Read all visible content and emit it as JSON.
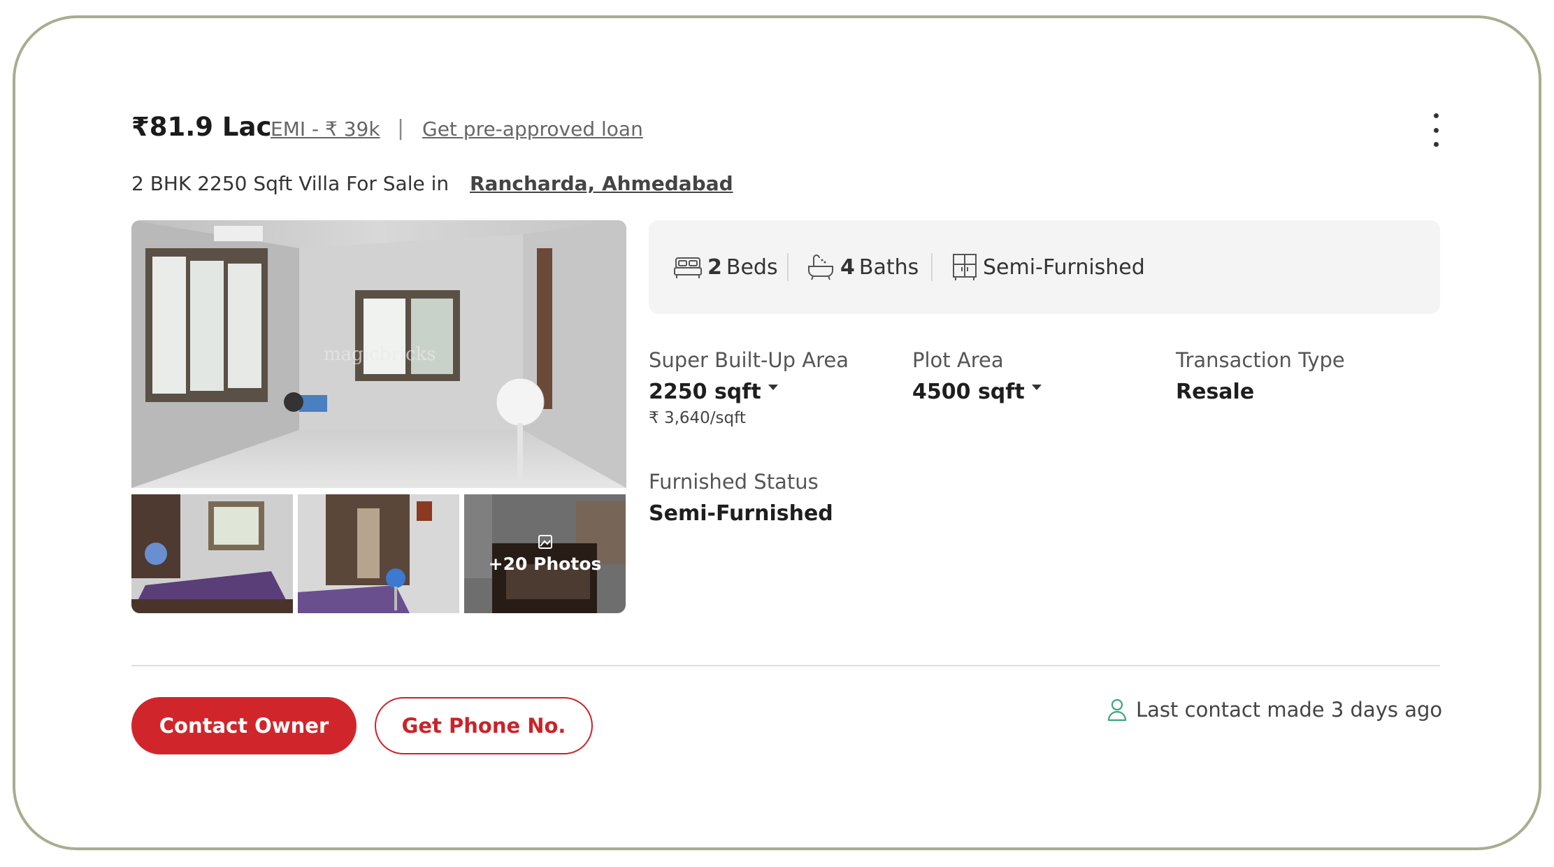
{
  "listing": {
    "price": "₹81.9 Lac",
    "emi_label": "EMI - ₹ 39k",
    "separator": "|",
    "loan_link": "Get pre-approved loan",
    "title_prefix": "2 BHK 2250 Sqft Villa For Sale in",
    "locality": "Rancharda, Ahmedabad"
  },
  "gallery": {
    "more_photos_label": "+20 Photos",
    "watermark": "magicbricks"
  },
  "amenities": {
    "beds_count": "2",
    "beds_label": "Beds",
    "baths_count": "4",
    "baths_label": "Baths",
    "furnishing": "Semi-Furnished"
  },
  "details": {
    "super_area_label": "Super Built-Up Area",
    "super_area_value": "2250 sqft",
    "price_per_sqft": "₹ 3,640/sqft",
    "plot_area_label": "Plot Area",
    "plot_area_value": "4500 sqft",
    "transaction_label": "Transaction Type",
    "transaction_value": "Resale",
    "furnished_label": "Furnished Status",
    "furnished_value": "Semi-Furnished"
  },
  "actions": {
    "contact_owner": "Contact Owner",
    "get_phone": "Get Phone No.",
    "last_contact": "Last contact made 3 days ago"
  },
  "colors": {
    "primary_red": "#d0262b",
    "card_border": "#a7ad8e",
    "contact_icon": "#3aa57a"
  },
  "icons": {
    "menu": "kebab-menu-icon",
    "beds": "bed-icon",
    "baths": "bathtub-icon",
    "furnishing": "wardrobe-icon",
    "photos": "image-icon",
    "contact": "user-icon"
  }
}
